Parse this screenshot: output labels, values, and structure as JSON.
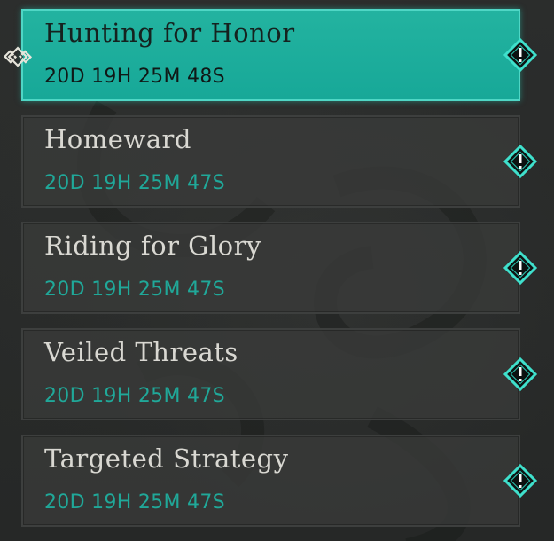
{
  "quests": [
    {
      "title": "Hunting for Honor",
      "timer": "20D 19H 25M 48S",
      "selected": true
    },
    {
      "title": "Homeward",
      "timer": "20D 19H 25M 47S",
      "selected": false
    },
    {
      "title": "Riding for Glory",
      "timer": "20D 19H 25M 47S",
      "selected": false
    },
    {
      "title": "Veiled Threats",
      "timer": "20D 19H 25M 47S",
      "selected": false
    },
    {
      "title": "Targeted Strategy",
      "timer": "20D 19H 25M 47S",
      "selected": false
    }
  ],
  "icons": {
    "alert": "exclamation-diamond-icon",
    "selected_marker": "knot-icon"
  },
  "colors": {
    "accent": "#1fb09e",
    "timer": "#20a899",
    "title": "#d9d8d2",
    "panel": "#3a3b3a"
  }
}
